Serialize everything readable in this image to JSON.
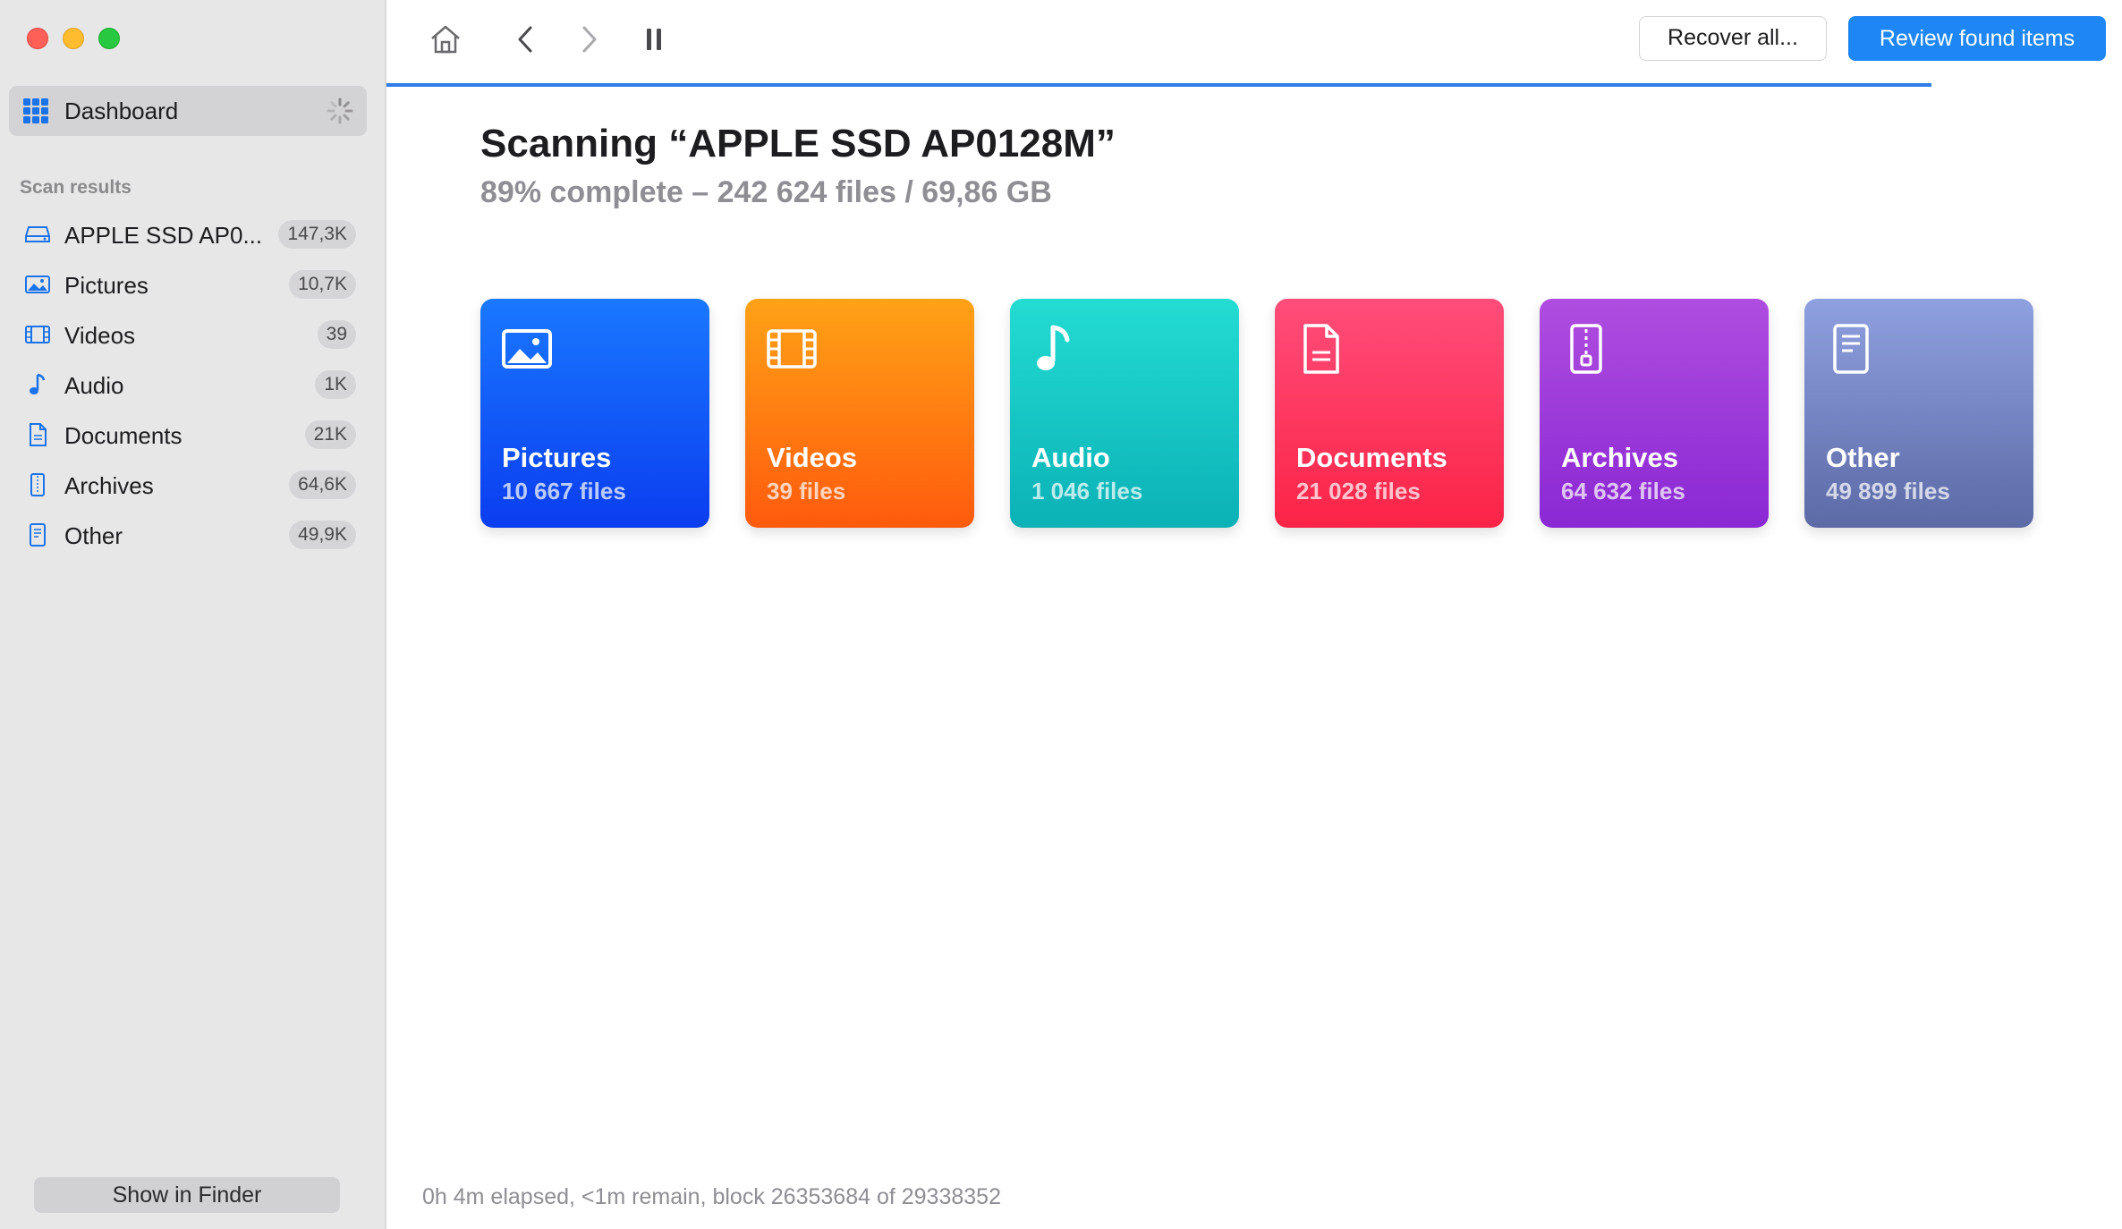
{
  "sidebar": {
    "dashboard_label": "Dashboard",
    "section_title": "Scan results",
    "items": [
      {
        "label": "APPLE SSD AP0...",
        "count": "147,3K",
        "icon": "drive-icon"
      },
      {
        "label": "Pictures",
        "count": "10,7K",
        "icon": "picture-icon"
      },
      {
        "label": "Videos",
        "count": "39",
        "icon": "film-icon"
      },
      {
        "label": "Audio",
        "count": "1K",
        "icon": "music-note-icon"
      },
      {
        "label": "Documents",
        "count": "21K",
        "icon": "document-icon"
      },
      {
        "label": "Archives",
        "count": "64,6K",
        "icon": "archive-icon"
      },
      {
        "label": "Other",
        "count": "49,9K",
        "icon": "other-file-icon"
      }
    ],
    "finder_button": "Show in Finder"
  },
  "toolbar": {
    "recover_label": "Recover all...",
    "review_label": "Review found items"
  },
  "scan": {
    "title": "Scanning “APPLE SSD AP0128M”",
    "subtitle": "89% complete – 242 624 files / 69,86 GB",
    "progress": 0.89,
    "status": "0h 4m elapsed, <1m remain, block 26353684 of 29338352"
  },
  "cards": [
    {
      "label": "Pictures",
      "count": "10 667 files",
      "icon": "picture-icon"
    },
    {
      "label": "Videos",
      "count": "39 files",
      "icon": "film-icon"
    },
    {
      "label": "Audio",
      "count": "1 046 files",
      "icon": "music-note-icon"
    },
    {
      "label": "Documents",
      "count": "21 028 files",
      "icon": "document-icon"
    },
    {
      "label": "Archives",
      "count": "64 632 files",
      "icon": "archive-icon"
    },
    {
      "label": "Other",
      "count": "49 899 files",
      "icon": "other-file-icon"
    }
  ],
  "colors": {
    "accent": "#1f86f5",
    "sidebar_icon": "#1a73e8"
  }
}
